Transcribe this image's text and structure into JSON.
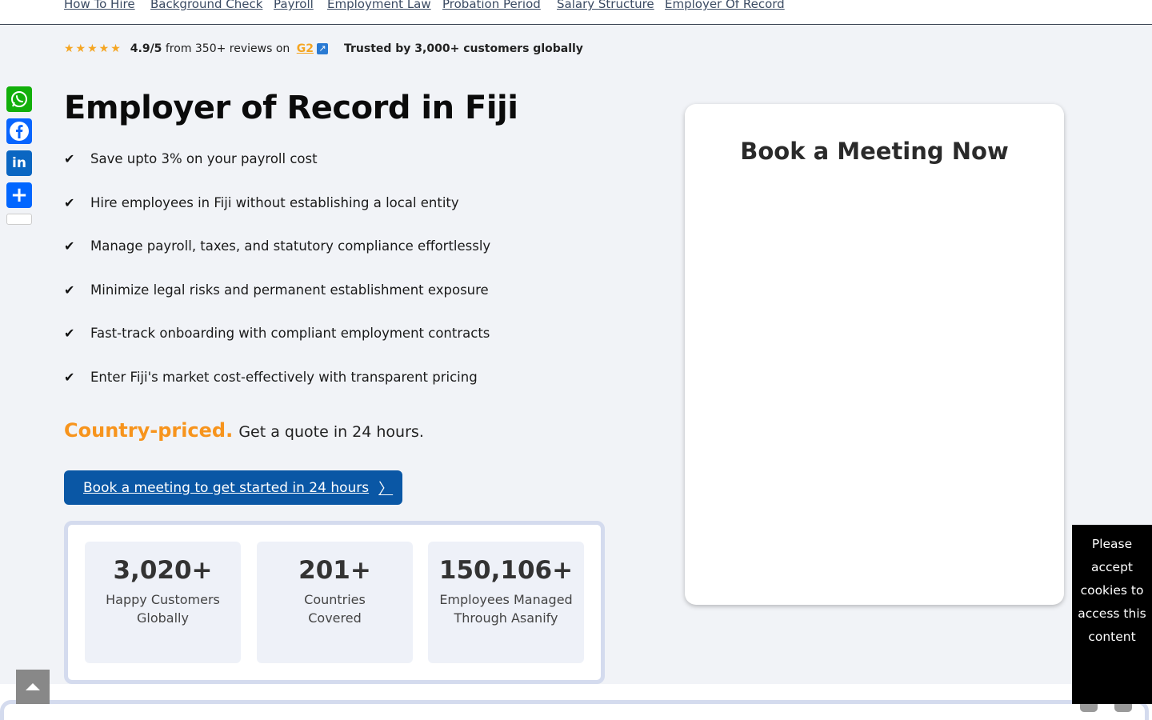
{
  "nav": {
    "links": [
      "How To Hire",
      "Background Check",
      "Payroll",
      "Employment Law",
      "Probation Period",
      "Salary Structure",
      "Employer Of Record"
    ]
  },
  "ratings": {
    "stars": "★★★★★",
    "score": "4.9/5",
    "from_text": " from 350+ reviews on ",
    "platform": "G2",
    "ext_icon": "↗",
    "trusted": "Trusted by 3,000+ customers globally"
  },
  "social": {
    "whatsapp_icon": "whatsapp-icon",
    "facebook_glyph": "f",
    "linkedin_glyph": "in",
    "share_glyph": "+"
  },
  "hero": {
    "title": "Employer of Record in Fiji",
    "check": "✔",
    "bullets": [
      "Save upto 3% on your payroll cost",
      "Hire employees in Fiji without establishing a local entity",
      "Manage payroll, taxes, and statutory compliance effortlessly",
      "Minimize legal risks and permanent establishment exposure",
      "Fast-track onboarding with compliant employment contracts",
      "Enter Fiji's market cost-effectively with transparent pricing"
    ],
    "pricing_accent": "Country-priced.",
    "pricing_rest": "Get a quote in 24 hours.",
    "cta_label": "Book a meeting to get started in 24 hours",
    "cta_arrow": "〉"
  },
  "stats": [
    {
      "value": "3,020+",
      "label": "Happy Customers Globally"
    },
    {
      "value": "201+",
      "label": "Countries Covered"
    },
    {
      "value": "150,106+",
      "label": "Employees Managed Through Asanify"
    }
  ],
  "meeting": {
    "title": "Book a Meeting Now"
  },
  "cookie": {
    "message": "Please accept cookies to access this content"
  },
  "colors": {
    "accent_orange": "#f7941d",
    "cta_blue": "#0a57a5",
    "whatsapp_green": "#12af0a",
    "facebook_blue": "#0965fe",
    "linkedin_blue": "#0a66c2"
  }
}
